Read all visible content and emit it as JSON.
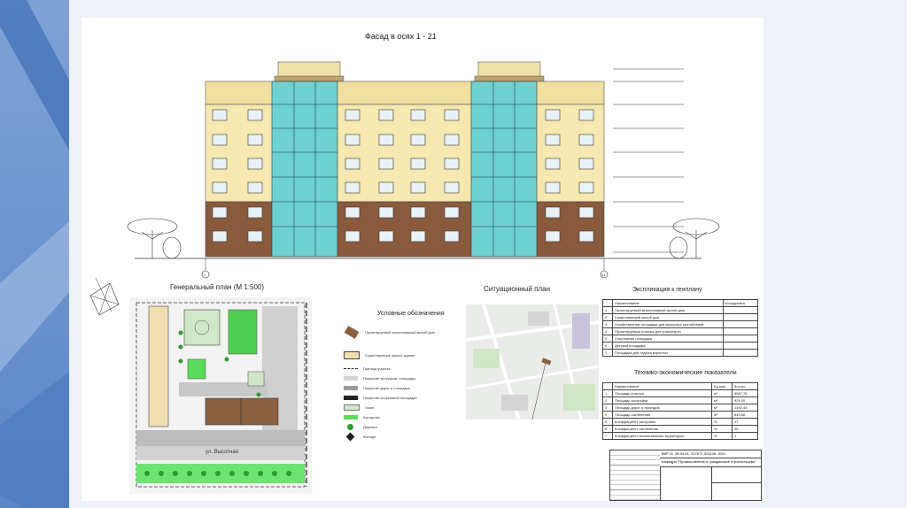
{
  "facade": {
    "title": "Фасад в осях 1 - 21",
    "axis_left": "1",
    "axis_right": "21"
  },
  "general_plan": {
    "title": "Генеральный план (М 1:500)",
    "street": "ул. Высотная"
  },
  "situation_plan": {
    "title": "Ситуационный план"
  },
  "legend": {
    "title": "Условные обозначения",
    "items": [
      "Проектируемый многоэтажный жилой дом",
      "Существующие жилые здания",
      "Граница участка",
      "Покрытие тротуаров, площадок",
      "Покрытие дорог и площадок",
      "Покрытие спортивной площадки",
      "Газон",
      "Кустарник",
      "Деревья",
      "Фонари"
    ]
  },
  "explication": {
    "title": "Экспликация к генплану",
    "header": [
      "Наименование",
      "Координата"
    ],
    "rows": [
      "Проектируемый многоэтажный жилой дом",
      "Существующий жилой дом",
      "Хозяйственные площадки для мусорных контейнеров",
      "Проектируемая стоянка для транспорта",
      "Спортивная площадка",
      "Детская площадка",
      "Площадка для отдыха взрослых"
    ]
  },
  "tep": {
    "title": "Технико-экономические показатели",
    "header": [
      "Наименование",
      "Ед.изм.",
      "Кол-во"
    ],
    "rows": [
      [
        "Площадь участка",
        "м²",
        "5567,76"
      ],
      [
        "Площадь застройки",
        "м²",
        "925,00"
      ],
      [
        "Площадь дорог и проездов",
        "м²",
        "1492,48"
      ],
      [
        "Площадь озеленения",
        "м²",
        "849,58"
      ],
      [
        "Коэффициент застройки",
        "%",
        "17"
      ],
      [
        "Коэффициент озеленения",
        "%",
        "26"
      ],
      [
        "Коэффициент использования территории",
        "%",
        "1"
      ]
    ]
  },
  "stamp": {
    "code": "ВКР 11. 08.03.01. 2178 П. 021106. 2021",
    "chair": "Кафедра \"Промышленное и гражданское строительство\""
  }
}
